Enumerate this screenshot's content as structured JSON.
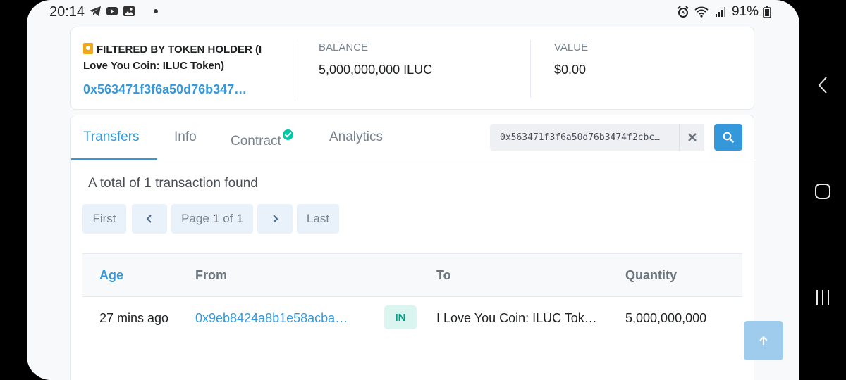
{
  "status_bar": {
    "time": "20:14",
    "battery": "91%",
    "left_icons": [
      "telegram-icon",
      "youtube-icon",
      "gallery-icon"
    ],
    "right_icons": [
      "alarm-icon",
      "wifi-icon",
      "signal-icon",
      "battery-icon"
    ]
  },
  "holder": {
    "title": "FILTERED BY TOKEN HOLDER (I Love You Coin: ILUC Token)",
    "address": "0x563471f3f6a50d76b347…",
    "balance_label": "BALANCE",
    "balance": "5,000,000,000 ILUC",
    "value_label": "VALUE",
    "value": "$0.00"
  },
  "tabs": [
    {
      "label": "Transfers",
      "active": true
    },
    {
      "label": "Info",
      "active": false
    },
    {
      "label": "Contract",
      "active": false,
      "verified": true
    },
    {
      "label": "Analytics",
      "active": false
    }
  ],
  "search": {
    "value": "0x563471f3f6a50d76b3474f2cbc…"
  },
  "summary": "A total of 1 transaction found",
  "pagination": {
    "first": "First",
    "page_word": "Page",
    "current": "1",
    "of_word": "of",
    "total": "1",
    "last": "Last"
  },
  "table": {
    "headers": [
      "Age",
      "From",
      "To",
      "Quantity"
    ],
    "rows": [
      {
        "age": "27 mins ago",
        "from": "0x9eb8424a8b1e58acba…",
        "direction": "IN",
        "to": "I Love You Coin: ILUC Tok…",
        "quantity": "5,000,000,000"
      }
    ]
  },
  "colors": {
    "accent": "#3498db",
    "success": "#00c9a7",
    "badge_bg": "#daf4ef",
    "holder_badge": "#f0a81a"
  }
}
